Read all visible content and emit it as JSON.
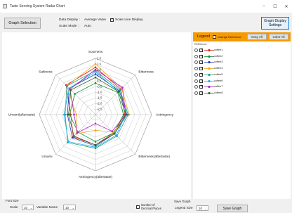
{
  "window": {
    "title": "Taste Sensing System  Radar Chart",
    "min_glyph": "–",
    "max_glyph": "☐",
    "close_glyph": "✕"
  },
  "toolbar": {
    "graph_selection": "Graph Selection",
    "data_display_label": "Data Display :",
    "data_display_value": "Average Value",
    "scale_line_display": "Scale Line Display",
    "scale_line_checked": true,
    "scale_mode_label": "Scale Mode :",
    "scale_mode_value": "Auto",
    "graph_display_settings": "Graph Display Settings"
  },
  "legend": {
    "title": "Legend",
    "change_reference": "Change Reference",
    "gray_all": "Gray All",
    "color_all": "Color All",
    "reference_label": "Reference",
    "items": [
      {
        "name": "coffee1",
        "color": "#e0241a",
        "checked": true
      },
      {
        "name": "coffee2",
        "color": "#1c8a3a",
        "checked": true
      },
      {
        "name": "coffee3",
        "color": "#1f3fbf",
        "checked": true
      },
      {
        "name": "coffee4",
        "color": "#f2a51c",
        "checked": true
      },
      {
        "name": "coffee5",
        "color": "#1aa07f",
        "checked": true
      },
      {
        "name": "coffee6",
        "color": "#19b2e8",
        "checked": true
      },
      {
        "name": "coffee7",
        "color": "#b428c6",
        "checked": true
      },
      {
        "name": "coffee8",
        "color": "#2f6b2f",
        "checked": true
      }
    ]
  },
  "chart_data": {
    "type": "radar",
    "axes": [
      "Sourness",
      "Bitterness",
      "Astringency",
      "Bitterness(aftertaste)",
      "Astringency(aftertaste)",
      "Umami",
      "Umami(aftertaste)",
      "Saltiness"
    ],
    "ticks": [
      "2.0",
      "1.5",
      "1.0",
      "0.5",
      "0.0",
      "-0.5",
      "-1.0",
      "-1.5",
      "-2.0",
      "-2.5"
    ],
    "rmin": -3.0,
    "rmax": 2.0,
    "series": [
      {
        "name": "coffee1",
        "values": [
          1.2,
          0.2,
          -0.4,
          -0.7,
          -0.3,
          -0.2,
          -0.8,
          0.7
        ]
      },
      {
        "name": "coffee2",
        "values": [
          -0.2,
          -0.2,
          -0.5,
          -0.7,
          -0.6,
          -0.8,
          -0.7,
          -0.4
        ]
      },
      {
        "name": "coffee3",
        "values": [
          0.6,
          0.0,
          -0.2,
          -0.6,
          -0.2,
          -0.1,
          -0.5,
          0.3
        ]
      },
      {
        "name": "coffee4",
        "values": [
          1.5,
          0.3,
          0.0,
          -0.8,
          -1.6,
          -0.6,
          -1.3,
          0.6
        ]
      },
      {
        "name": "coffee5",
        "values": [
          0.9,
          0.1,
          -0.1,
          -0.3,
          0.0,
          0.5,
          -0.3,
          0.6
        ]
      },
      {
        "name": "coffee6",
        "values": [
          0.8,
          -0.1,
          -0.3,
          -0.4,
          -0.1,
          0.4,
          -0.2,
          0.3
        ]
      },
      {
        "name": "coffee7",
        "values": [
          1.0,
          0.4,
          -0.3,
          -0.9,
          -2.2,
          -0.7,
          -1.1,
          0.2
        ]
      },
      {
        "name": "coffee8",
        "values": [
          0.3,
          -0.1,
          -0.3,
          -0.6,
          -0.3,
          -0.3,
          -0.6,
          0.1
        ]
      }
    ],
    "grid": true,
    "legend_position": "right"
  },
  "bottom": {
    "font_size_label": "Font Size",
    "scale_label": "Scale",
    "scale_value": "10",
    "variable_name_label": "Variable Name",
    "variable_name_value": "10",
    "decimal_places_label": "Number of Decimal Places",
    "save_graph_label": "Save Graph",
    "legend_size_label": "Legend Size",
    "legend_size_value": "10",
    "save_graph_button": "Save Graph",
    "dropdown_arrow": "⌄"
  }
}
